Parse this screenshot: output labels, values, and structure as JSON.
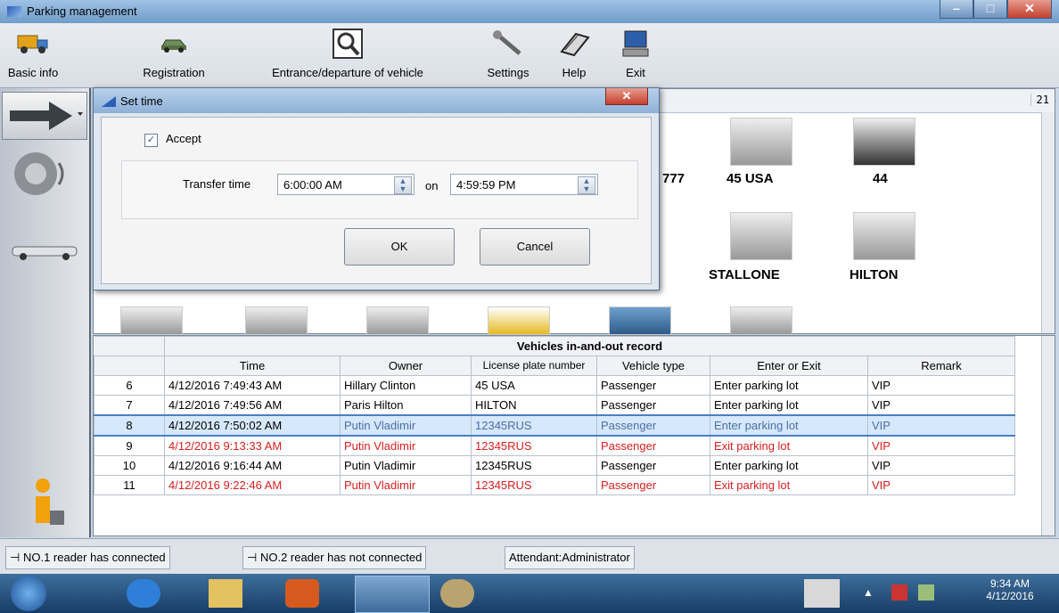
{
  "window": {
    "title": "Parking management"
  },
  "toolbar": {
    "items": [
      {
        "label": "Basic info",
        "icon": "truck-icon"
      },
      {
        "label": "Registration",
        "icon": "car-icon"
      },
      {
        "label": "Entrance/departure of vehicle",
        "icon": "magnifier-icon"
      },
      {
        "label": "Settings",
        "icon": "wrench-icon"
      },
      {
        "label": "Help",
        "icon": "book-icon"
      },
      {
        "label": "Exit",
        "icon": "computer-icon"
      }
    ]
  },
  "image_panel": {
    "counter": "21",
    "cars": [
      {
        "label": "777"
      },
      {
        "label": "45 USA"
      },
      {
        "label": "44"
      },
      {
        "label": "STALLONE"
      },
      {
        "label": "HILTON"
      }
    ]
  },
  "dialog": {
    "title": "Set time",
    "accept_label": "Accept",
    "accept_checked": true,
    "transfer_label": "Transfer time",
    "from_time": "6:00:00 AM",
    "on_label": "on",
    "to_time": "4:59:59 PM",
    "ok_label": "OK",
    "cancel_label": "Cancel"
  },
  "record": {
    "title": "Vehicles in-and-out record",
    "columns": [
      "Time",
      "Owner",
      "License plate number",
      "Vehicle type",
      "Enter or Exit",
      "Remark"
    ],
    "rows": [
      {
        "no": "6",
        "time": "4/12/2016 7:49:43 AM",
        "owner": "Hillary Clinton",
        "plate": "45 USA",
        "type": "Passenger",
        "action": "Enter parking lot",
        "remark": "VIP"
      },
      {
        "no": "7",
        "time": "4/12/2016 7:49:56 AM",
        "owner": "Paris Hilton",
        "plate": "HILTON",
        "type": "Passenger",
        "action": "Enter parking lot",
        "remark": "VIP"
      },
      {
        "no": "8",
        "time": "4/12/2016 7:50:02 AM",
        "owner": "Putin Vladimir",
        "plate": "12345RUS",
        "type": "Passenger",
        "action": "Enter parking lot",
        "remark": "VIP"
      },
      {
        "no": "9",
        "time": "4/12/2016 9:13:33 AM",
        "owner": "Putin Vladimir",
        "plate": "12345RUS",
        "type": "Passenger",
        "action": "Exit parking lot",
        "remark": "VIP"
      },
      {
        "no": "10",
        "time": "4/12/2016 9:16:44 AM",
        "owner": "Putin Vladimir",
        "plate": "12345RUS",
        "type": "Passenger",
        "action": "Enter parking lot",
        "remark": "VIP"
      },
      {
        "no": "11",
        "time": "4/12/2016 9:22:46 AM",
        "owner": "Putin Vladimir",
        "plate": "12345RUS",
        "type": "Passenger",
        "action": "Exit parking lot",
        "remark": "VIP"
      }
    ]
  },
  "status": {
    "reader1": "NO.1 reader has connected",
    "reader2": "NO.2 reader has not connected",
    "attendant": "Attendant:Administrator"
  },
  "taskbar": {
    "time": "9:34 AM",
    "date": "4/12/2016"
  },
  "colors": {
    "exit_row": "#d81e1e",
    "selected_row": "#d6e8fb"
  }
}
